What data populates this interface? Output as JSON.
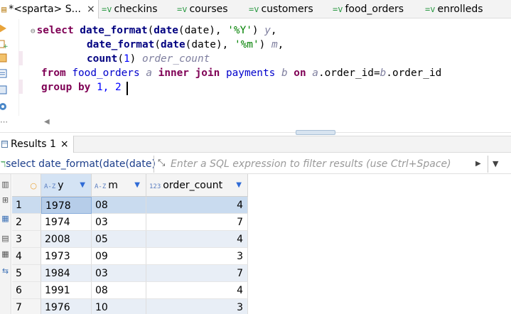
{
  "editor_tabs": [
    {
      "label": "*<sparta> S...",
      "active": true,
      "icon": "sql-editor-icon"
    },
    {
      "label": "checkins",
      "active": false,
      "icon": "table-icon"
    },
    {
      "label": "courses",
      "active": false,
      "icon": "table-icon"
    },
    {
      "label": "customers",
      "active": false,
      "icon": "table-icon"
    },
    {
      "label": "food_orders",
      "active": false,
      "icon": "table-icon"
    },
    {
      "label": "enrolleds",
      "active": false,
      "icon": "table-icon"
    }
  ],
  "tab_close_glyph": "×",
  "table_tab_glyph": "=v",
  "sql": {
    "line1": {
      "kw_select": "select",
      "fn1": "date_format",
      "fn2": "date",
      "arg": "date",
      "str": "'%Y'",
      "alias": "y"
    },
    "line2": {
      "fn1": "date_format",
      "fn2": "date",
      "arg": "date",
      "str": "'%m'",
      "alias": "m"
    },
    "line3": {
      "fn": "count",
      "arg": "1",
      "alias": "order_count"
    },
    "line4": {
      "kw_from": "from",
      "table1": "food_orders",
      "alias1": "a",
      "kw_join": "inner join",
      "table2": "payments",
      "alias2": "b",
      "kw_on": "on",
      "cond_a": "a",
      "cond_col_a": "order_id",
      "cond_b": "b",
      "cond_col_b": "order_id"
    },
    "line5": {
      "kw_group": "group by",
      "args": "1, 2"
    }
  },
  "results": {
    "tab_label": "Results 1",
    "query_label": "select date_format(date(date)",
    "filter_placeholder": "Enter a SQL expression to filter results (use Ctrl+Space)",
    "columns": [
      {
        "type": "A-Z",
        "name": "y"
      },
      {
        "type": "A-Z",
        "name": "m"
      },
      {
        "type": "123",
        "name": "order_count"
      }
    ],
    "rows": [
      {
        "n": "1",
        "y": "1978",
        "m": "08",
        "order_count": "4"
      },
      {
        "n": "2",
        "y": "1974",
        "m": "03",
        "order_count": "7"
      },
      {
        "n": "3",
        "y": "2008",
        "m": "05",
        "order_count": "4"
      },
      {
        "n": "4",
        "y": "1973",
        "m": "09",
        "order_count": "3"
      },
      {
        "n": "5",
        "y": "1984",
        "m": "03",
        "order_count": "7"
      },
      {
        "n": "6",
        "y": "1991",
        "m": "08",
        "order_count": "4"
      },
      {
        "n": "7",
        "y": "1976",
        "m": "10",
        "order_count": "3"
      }
    ]
  },
  "colors": {
    "keyword": "#7f0055",
    "string": "#008000",
    "alias": "#7f7f9f",
    "table": "#0000cc",
    "selection": "#c9dbef"
  }
}
